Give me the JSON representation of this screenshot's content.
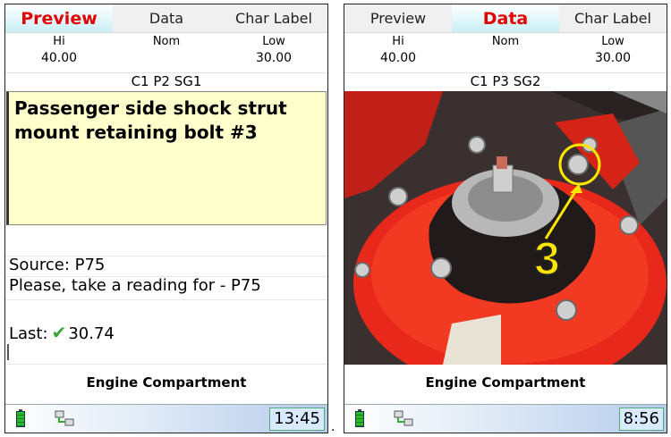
{
  "screens": [
    {
      "tabs": [
        "Preview",
        "Data",
        "Char Label"
      ],
      "active_tab": 0,
      "limits": [
        {
          "label": "Hi",
          "value": "40.00"
        },
        {
          "label": "Nom",
          "value": ""
        },
        {
          "label": "Low",
          "value": "30.00"
        }
      ],
      "id_line": "C1 P2 SG1",
      "description": "Passenger side shock strut mount retaining bolt #3",
      "source": "Source: P75",
      "prompt": "Please, take a reading for - P75",
      "last_label": "Last:",
      "last_value": "30.74",
      "footer": "Engine Compartment",
      "time": "13:45"
    },
    {
      "tabs": [
        "Preview",
        "Data",
        "Char Label"
      ],
      "active_tab": 1,
      "limits": [
        {
          "label": "Hi",
          "value": "40.00"
        },
        {
          "label": "Nom",
          "value": ""
        },
        {
          "label": "Low",
          "value": "30.00"
        }
      ],
      "id_line": "C1 P3 SG2",
      "photo_callout": "3",
      "footer": "Engine Compartment",
      "time": "8:56"
    }
  ],
  "separator": ".",
  "colors": {
    "active_tab_text": "#e00000",
    "note_bg": "#ffffcc",
    "strut_red": "#e8281a",
    "callout_yellow": "#ffe600"
  },
  "icons": {
    "battery": "battery-icon",
    "network": "network-icon",
    "check": "checkmark-icon"
  }
}
